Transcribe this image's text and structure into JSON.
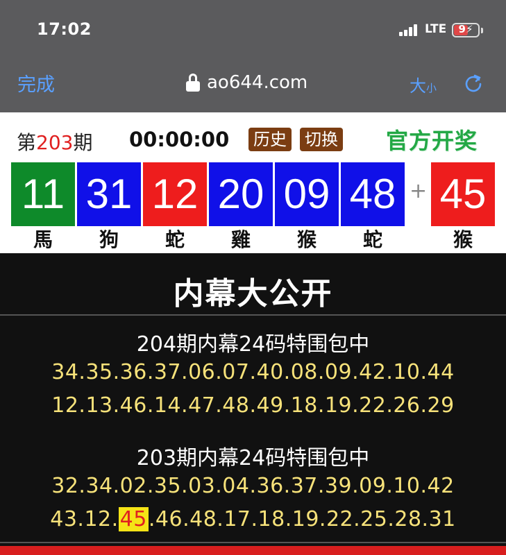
{
  "status_bar": {
    "time": "17:02",
    "network": "LTE",
    "battery": "9"
  },
  "browser": {
    "done_label": "完成",
    "url": "ao644.com",
    "size_big": "大",
    "size_small": "小"
  },
  "result": {
    "period_prefix": "第",
    "period_number": "203",
    "period_suffix": "期",
    "countdown": "00:00:00",
    "history_label": "历史",
    "switch_label": "切换",
    "official_label": "官方开奖",
    "plus": "+",
    "balls": [
      {
        "number": "11",
        "zodiac": "馬",
        "color": "#0e8a2a"
      },
      {
        "number": "31",
        "zodiac": "狗",
        "color": "#1010e8"
      },
      {
        "number": "12",
        "zodiac": "蛇",
        "color": "#ee1d1d"
      },
      {
        "number": "20",
        "zodiac": "雞",
        "color": "#1010e8"
      },
      {
        "number": "09",
        "zodiac": "猴",
        "color": "#1010e8"
      },
      {
        "number": "48",
        "zodiac": "蛇",
        "color": "#1010e8"
      }
    ],
    "special_ball": {
      "number": "45",
      "zodiac": "猴",
      "color": "#ee1d1d"
    }
  },
  "dark_section": {
    "headline": "内幕大公开",
    "blocks": [
      {
        "title": "204期内幕24码特围包中",
        "line1": "34.35.36.37.06.07.40.08.09.42.10.44",
        "line2": "12.13.46.14.47.48.49.18.19.22.26.29"
      },
      {
        "title": "203期内幕24码特围包中",
        "line1": "32.34.02.35.03.04.36.37.39.09.10.42",
        "line2_before": "43.12.",
        "line2_hit": "45",
        "line2_after": ".46.48.17.18.19.22.25.28.31"
      }
    ]
  },
  "colors": {
    "accent_blue": "#5aa0ff",
    "brand_brown": "#7b3d12",
    "official_green": "#23a845",
    "number_yellow": "#f7e27a"
  }
}
